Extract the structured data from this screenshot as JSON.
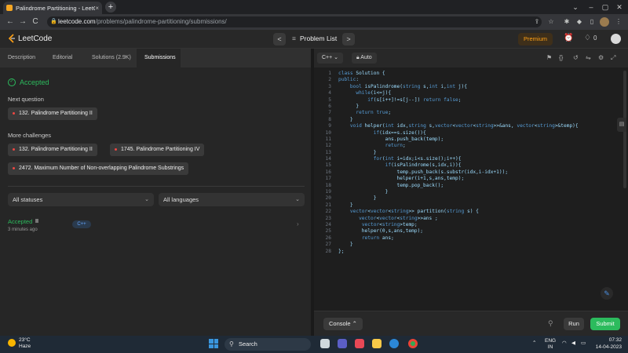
{
  "browser": {
    "tab_title": "Palindrome Partitioning - LeetCo",
    "tab_close": "×",
    "new_tab": "+",
    "url_host": "leetcode.com",
    "url_path": "/problems/palindrome-partitioning/submissions/",
    "back": "←",
    "forward": "→",
    "reload": "C"
  },
  "header": {
    "logo_text": "LeetCode",
    "prev": "<",
    "next": ">",
    "problem_list_icon": "≡",
    "problem_list": "Problem List",
    "premium": "Premium",
    "coins": "0"
  },
  "left": {
    "tabs": [
      "Description",
      "Editorial",
      "Solutions (2.9K)",
      "Submissions"
    ],
    "status": "Accepted",
    "next_question_heading": "Next question",
    "next_question": "132. Palindrome Partitioning II",
    "more_heading": "More challenges",
    "challenges": [
      "132. Palindrome Partitioning II",
      "1745. Palindrome Partitioning IV",
      "2472. Maximum Number of Non-overlapping Palindrome Substrings"
    ],
    "filter_status": "All statuses",
    "filter_language": "All languages",
    "submission": {
      "status": "Accepted",
      "time": "3 minutes ago",
      "language": "C++"
    }
  },
  "editor": {
    "language": "C++",
    "mode": "Auto",
    "lines": [
      "class Solution {",
      "public:",
      "    bool isPalindrome(string s,int i,int j){",
      "      while(i<=j){",
      "          if(s[i++]!=s[j--]) return false;",
      "      }",
      "      return true;",
      "    }",
      "    void helper(int idx,string s,vector<vector<string>>&ans, vector<string>&temp){",
      "            if(idx==s.size()){",
      "                ans.push_back(temp);",
      "                return;",
      "            }",
      "            for(int i=idx;i<s.size();i++){",
      "                if(isPalindrome(s,idx,i)){",
      "                    temp.push_back(s.substr(idx,i-idx+1));",
      "                    helper(i+1,s,ans,temp);",
      "                    temp.pop_back();",
      "                }",
      "            }",
      "    }",
      "    vector<vector<string>> partition(string s) {",
      "       vector<vector<string>>ans ;",
      "        vector<string>temp;",
      "        helper(0,s,ans,temp);",
      "        return ans;",
      "    }",
      "};"
    ],
    "console": "Console",
    "run": "Run",
    "submit": "Submit"
  },
  "taskbar": {
    "temp": "23°C",
    "weather": "Haze",
    "search": "Search",
    "lang1": "ENG",
    "lang2": "IN",
    "time": "07:32",
    "date": "14-04-2023"
  },
  "colors": {
    "accepted": "#2cbb5d",
    "premium": "#ffa116",
    "submit": "#2cbb5d",
    "keyword": "#569cd6"
  }
}
